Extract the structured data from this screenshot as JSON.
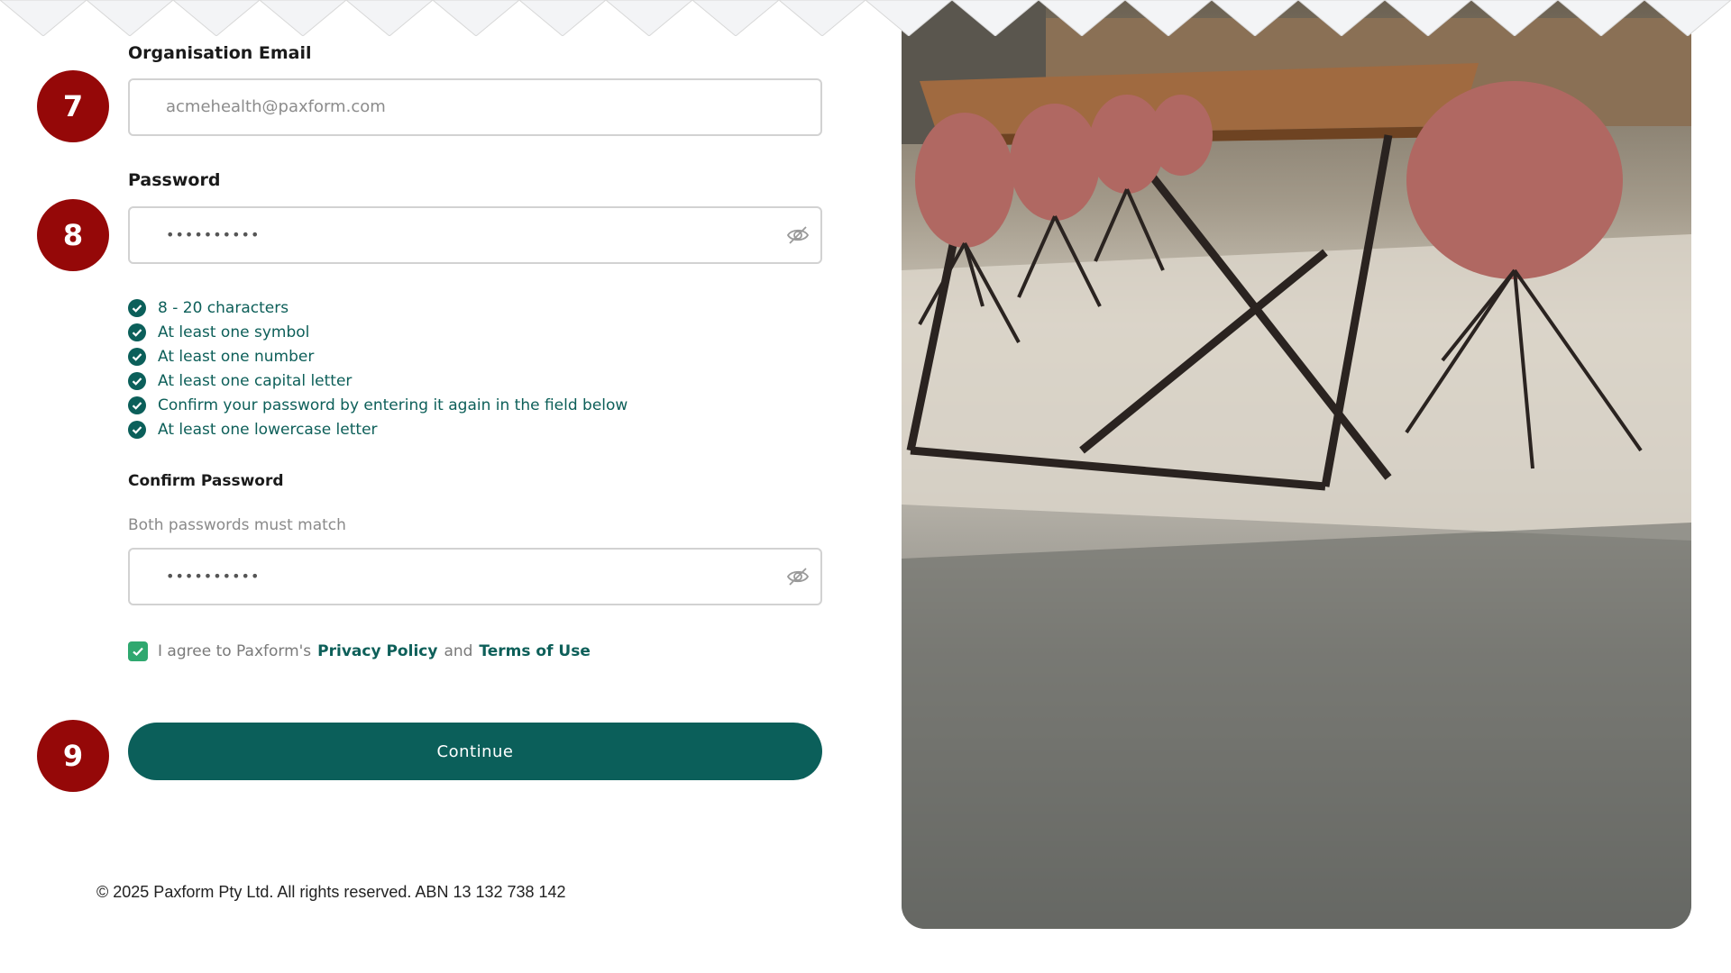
{
  "form": {
    "email": {
      "label": "Organisation Email",
      "value": "acmehealth@paxform.com",
      "step": "7"
    },
    "password": {
      "label": "Password",
      "value": "••••••••••",
      "step": "8"
    },
    "requirements": [
      "8 - 20 characters",
      "At least one symbol",
      "At least one number",
      "At least one capital letter",
      "Confirm your password by entering it again in the field below",
      "At least one lowercase letter"
    ],
    "confirm_password": {
      "label": "Confirm Password",
      "hint": "Both passwords must match",
      "value": "••••••••••"
    },
    "agreement": {
      "prefix": "I agree to Paxform's",
      "privacy_link": "Privacy Policy",
      "conjunction": "and",
      "terms_link": "Terms of Use",
      "checked": true
    },
    "continue": {
      "label": "Continue",
      "step": "9"
    }
  },
  "footer": {
    "copyright": "© 2025 Paxform Pty Ltd. All rights reserved. ABN 13 132 738 142"
  },
  "colors": {
    "primary": "#0b5f5a",
    "link": "#0d5f59",
    "badge": "#950808",
    "check": "#2fa86f"
  },
  "icons": {
    "password_toggle": "eye-slash-icon",
    "requirement": "check-circle-icon",
    "checkbox": "checkmark-icon"
  }
}
